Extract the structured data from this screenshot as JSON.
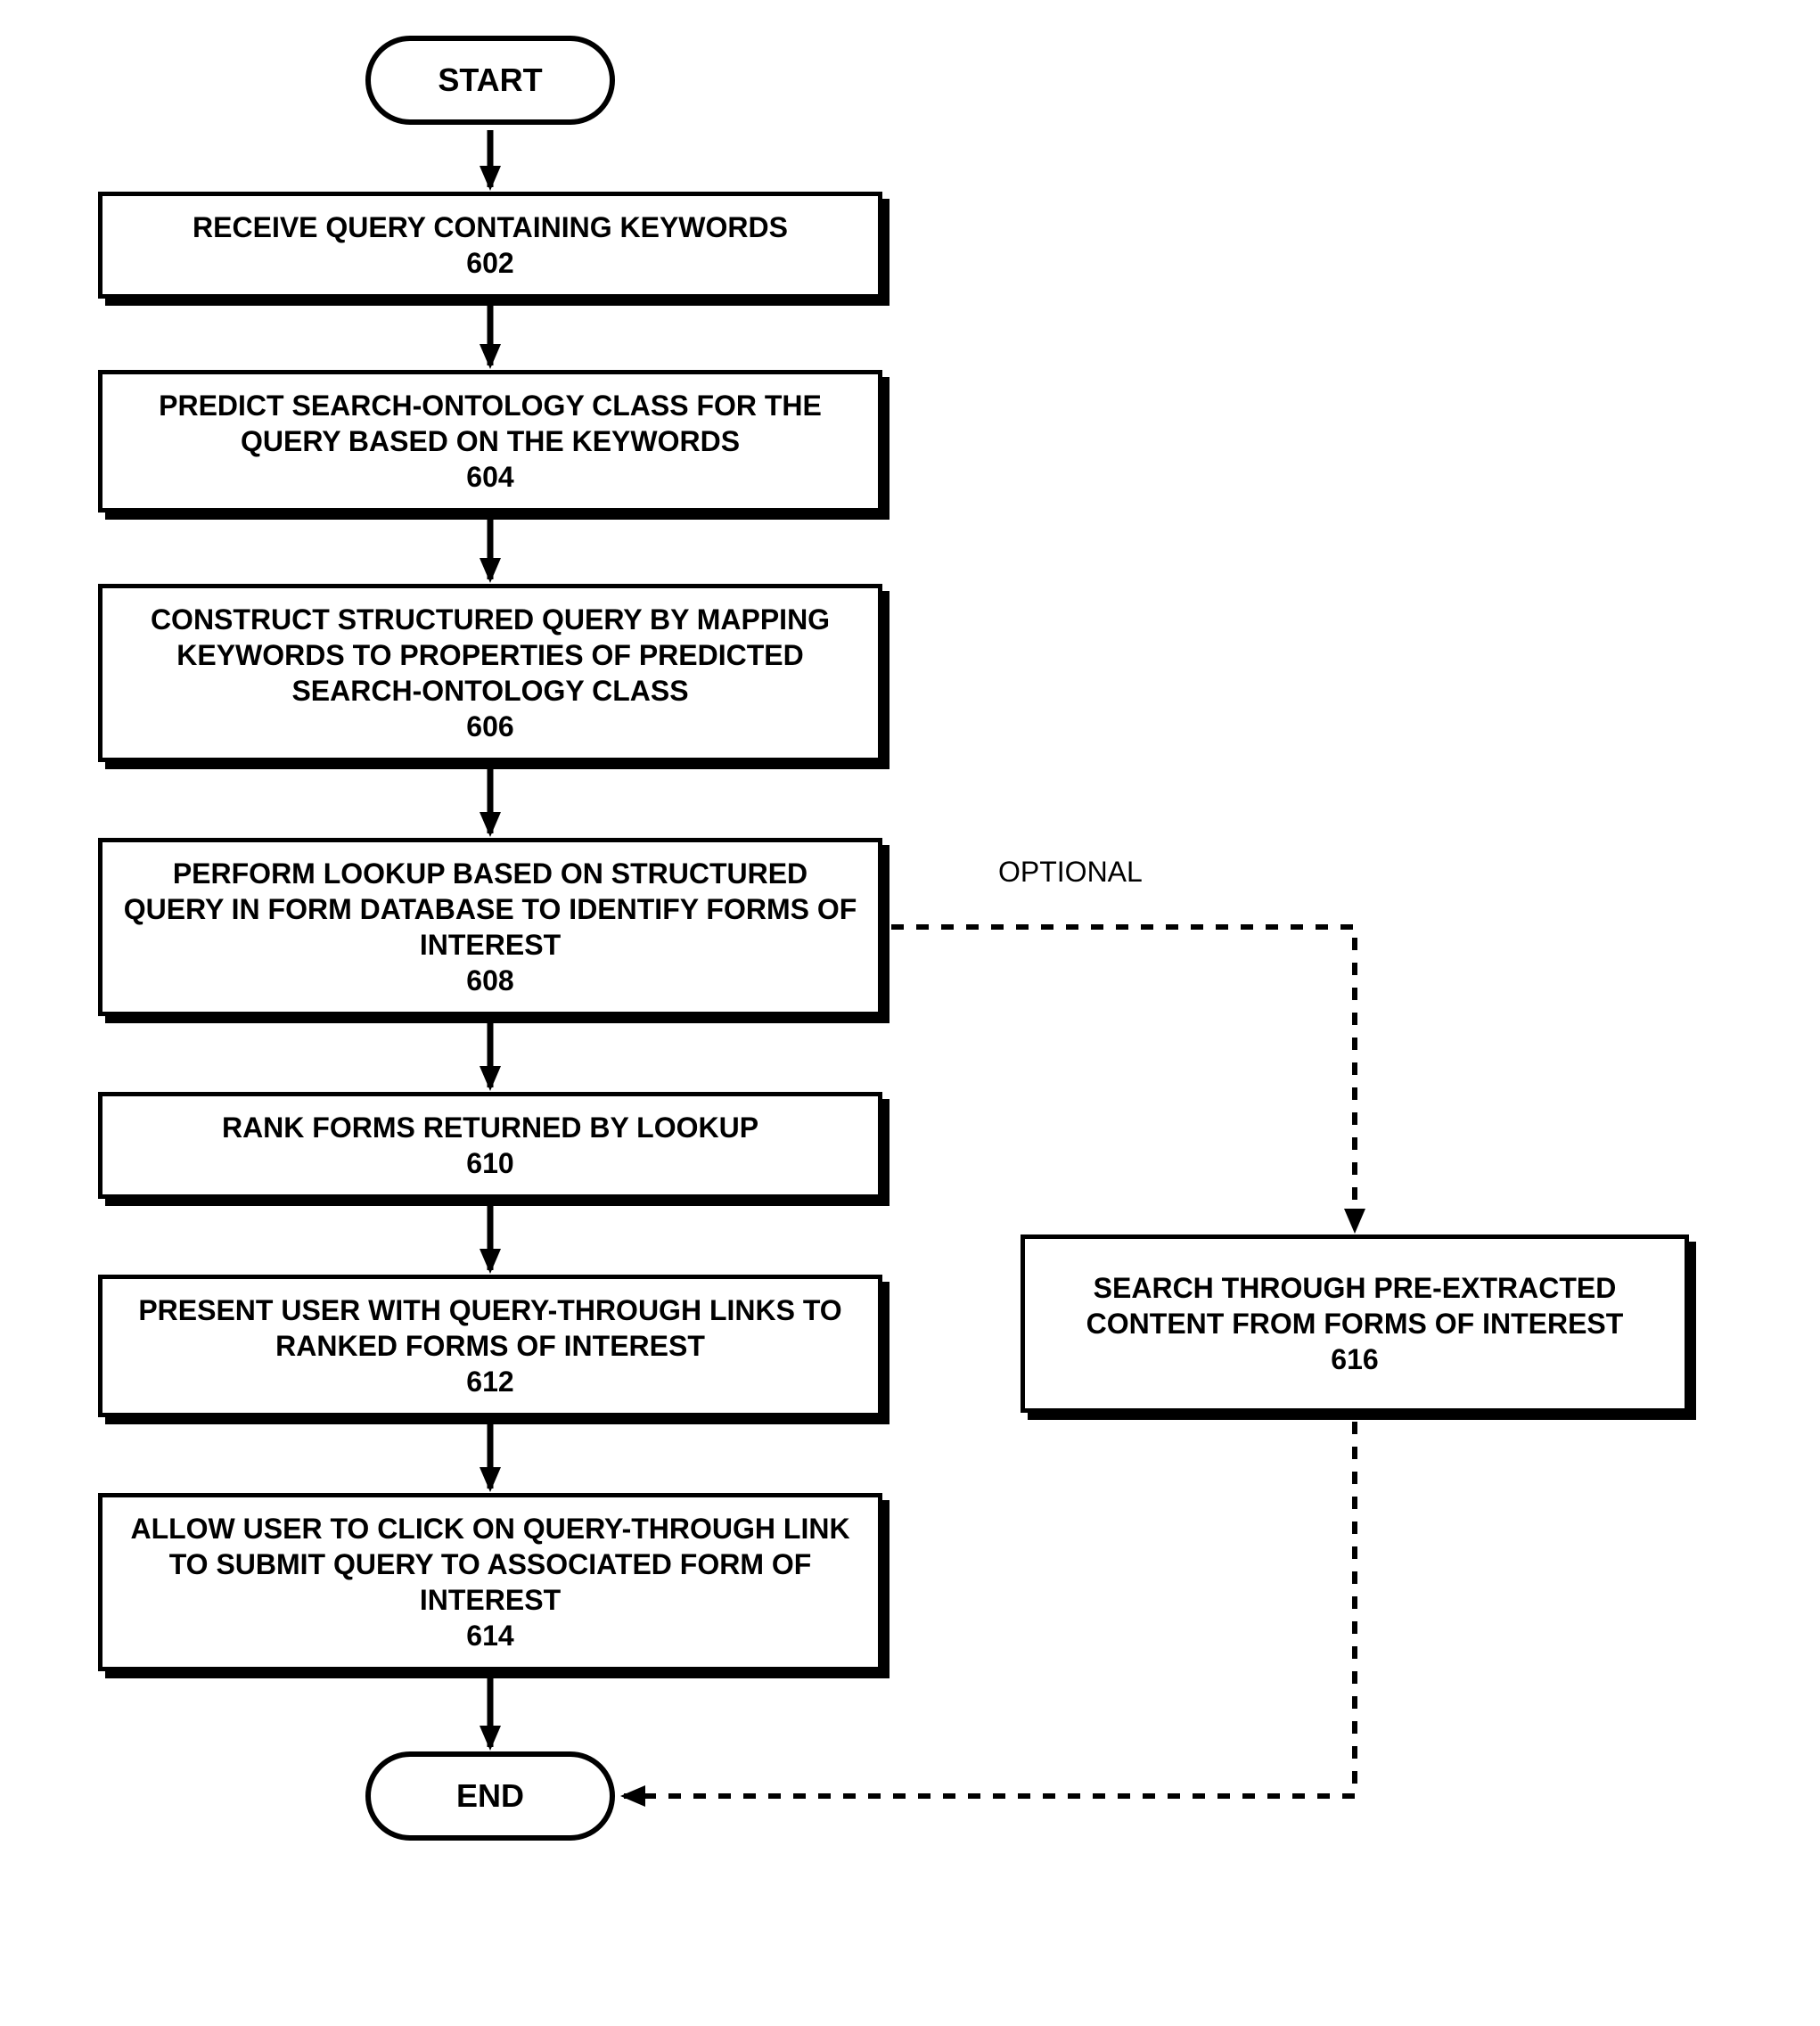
{
  "terminals": {
    "start": "START",
    "end": "END"
  },
  "steps": {
    "s602": {
      "text": "RECEIVE QUERY CONTAINING KEYWORDS",
      "num": "602"
    },
    "s604": {
      "text": "PREDICT SEARCH-ONTOLOGY CLASS FOR THE QUERY BASED ON THE KEYWORDS",
      "num": "604"
    },
    "s606": {
      "text": "CONSTRUCT STRUCTURED QUERY BY MAPPING KEYWORDS TO PROPERTIES OF PREDICTED SEARCH-ONTOLOGY CLASS",
      "num": "606"
    },
    "s608": {
      "text": "PERFORM LOOKUP BASED ON STRUCTURED QUERY IN FORM DATABASE TO IDENTIFY FORMS OF INTEREST",
      "num": "608"
    },
    "s610": {
      "text": "RANK FORMS RETURNED BY LOOKUP",
      "num": "610"
    },
    "s612": {
      "text": "PRESENT USER WITH QUERY-THROUGH LINKS TO RANKED FORMS OF INTEREST",
      "num": "612"
    },
    "s614": {
      "text": "ALLOW USER TO CLICK ON QUERY-THROUGH LINK TO SUBMIT QUERY TO ASSOCIATED FORM OF INTEREST",
      "num": "614"
    },
    "s616": {
      "text": "SEARCH THROUGH PRE-EXTRACTED CONTENT FROM FORMS OF INTEREST",
      "num": "616"
    }
  },
  "labels": {
    "optional": "OPTIONAL"
  }
}
